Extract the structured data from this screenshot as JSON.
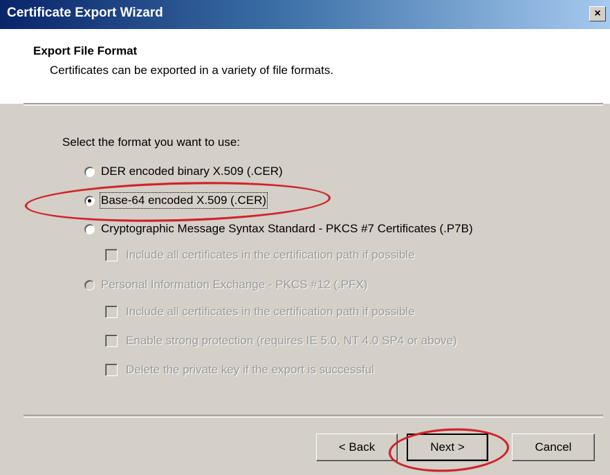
{
  "window": {
    "title": "Certificate Export Wizard",
    "close_glyph": "×"
  },
  "header": {
    "title": "Export File Format",
    "subtitle": "Certificates can be exported in a variety of file formats."
  },
  "prompt": "Select the format you want to use:",
  "options": [
    {
      "label": "DER encoded binary X.509 (.CER)",
      "checked": false,
      "enabled": true
    },
    {
      "label": "Base-64 encoded X.509 (.CER)",
      "checked": true,
      "enabled": true
    },
    {
      "label": "Cryptographic Message Syntax Standard - PKCS #7 Certificates (.P7B)",
      "checked": false,
      "enabled": true
    },
    {
      "label": "Personal Information Exchange - PKCS #12 (.PFX)",
      "checked": false,
      "enabled": false
    }
  ],
  "pkcs7_checkbox": {
    "label": "Include all certificates in the certification path if possible",
    "checked": false,
    "enabled": false
  },
  "pfx_checkboxes": [
    {
      "label": "Include all certificates in the certification path if possible",
      "checked": false,
      "enabled": false
    },
    {
      "label": "Enable strong protection (requires IE 5.0, NT 4.0 SP4 or above)",
      "checked": false,
      "enabled": false
    },
    {
      "label": "Delete the private key if the export is successful",
      "checked": false,
      "enabled": false
    }
  ],
  "buttons": {
    "back": "< Back",
    "next": "Next >",
    "cancel": "Cancel"
  },
  "annotation_color": "#d1202a"
}
